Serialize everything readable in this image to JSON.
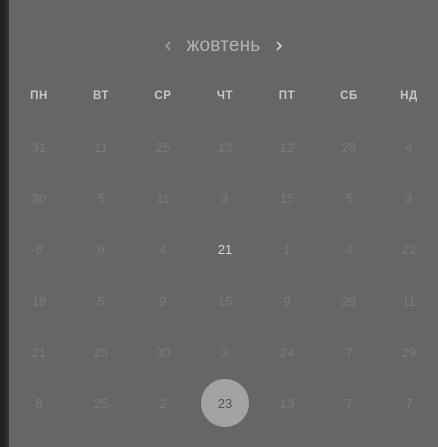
{
  "calendar": {
    "month": "жовтень",
    "prev_icon": "chevron-left-icon",
    "next_icon": "chevron-right-icon",
    "weekdays": [
      "ПН",
      "ВТ",
      "СР",
      "ЧТ",
      "ПТ",
      "СБ",
      "НД"
    ],
    "weeks": [
      [
        "31",
        "11",
        "25",
        "13",
        "12",
        "28",
        "4"
      ],
      [
        "30",
        "5",
        "11",
        "3",
        "15",
        "5",
        "3"
      ],
      [
        "8",
        "9",
        "4",
        "21",
        "1",
        "4",
        "22"
      ],
      [
        "18",
        "5",
        "9",
        "15",
        "9",
        "29",
        "11"
      ],
      [
        "21",
        "25",
        "30",
        "3",
        "24",
        "7",
        "29"
      ],
      [
        "8",
        "25",
        "2",
        "23",
        "13",
        "7",
        "7"
      ]
    ],
    "current_day": "21",
    "selected_day": "23"
  },
  "colors": {
    "background": "#666666",
    "selected_circle": "#a3a3a3",
    "muted_day": "#7a7a7a",
    "current_day": "#d0d0d0"
  }
}
